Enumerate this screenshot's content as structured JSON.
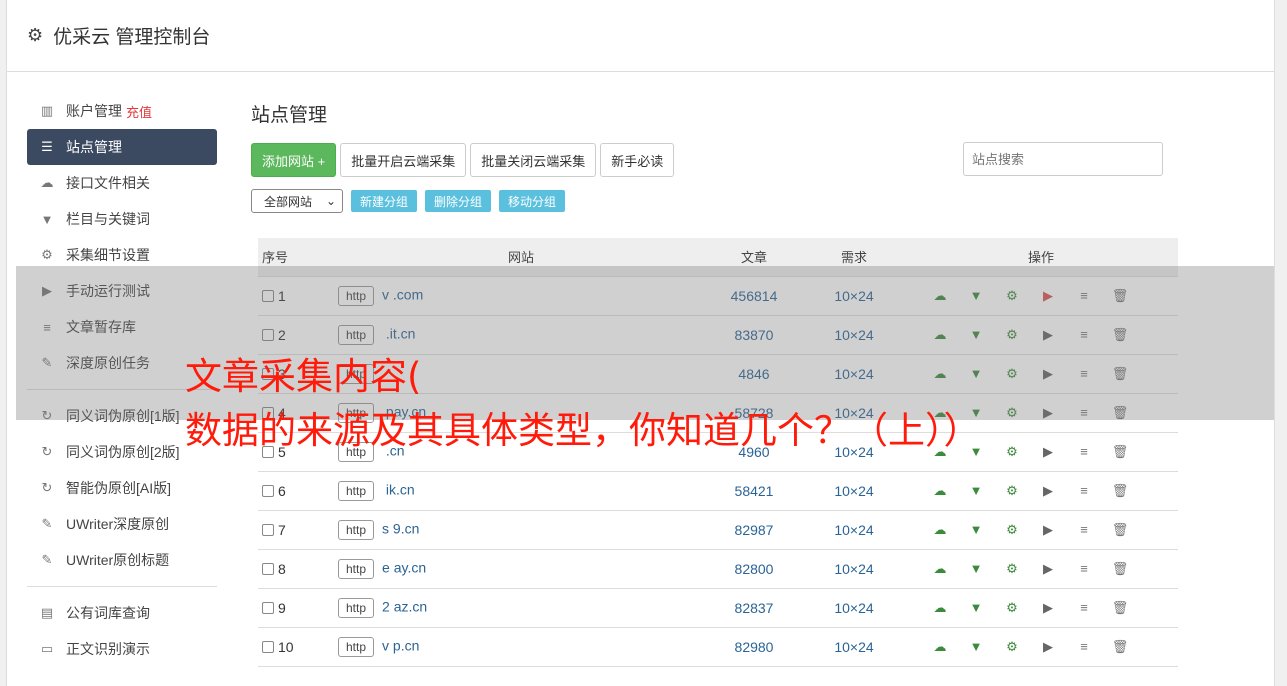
{
  "header": {
    "title": "优采云 管理控制台"
  },
  "sidebar": {
    "items": [
      {
        "label": "账户管理",
        "extra": "充值",
        "icon": "bar-chart-icon",
        "glyph": "▥",
        "active": false
      },
      {
        "label": "站点管理",
        "icon": "server-icon",
        "glyph": "☰",
        "active": true
      },
      {
        "label": "接口文件相关",
        "icon": "cloud-upload-icon",
        "glyph": "☁",
        "active": false
      },
      {
        "label": "栏目与关键词",
        "icon": "filter-icon",
        "glyph": "▼",
        "active": false
      },
      {
        "label": "采集细节设置",
        "icon": "cogs-icon",
        "glyph": "⚙",
        "active": false
      },
      {
        "label": "手动运行测试",
        "icon": "play-circle-icon",
        "glyph": "▶",
        "active": false
      },
      {
        "label": "文章暂存库",
        "icon": "database-icon",
        "glyph": "≡",
        "active": false
      },
      {
        "label": "深度原创任务",
        "icon": "edit-icon",
        "glyph": "✎",
        "active": false
      }
    ],
    "items2": [
      {
        "label": "同义词伪原创[1版]",
        "icon": "refresh-icon",
        "glyph": "↻"
      },
      {
        "label": "同义词伪原创[2版]",
        "icon": "refresh-icon",
        "glyph": "↻"
      },
      {
        "label": "智能伪原创[AI版]",
        "icon": "refresh-icon",
        "glyph": "↻"
      },
      {
        "label": "UWriter深度原创",
        "icon": "edit-icon",
        "glyph": "✎"
      },
      {
        "label": "UWriter原创标题",
        "icon": "edit-icon",
        "glyph": "✎"
      }
    ],
    "items3": [
      {
        "label": "公有词库查询",
        "icon": "book-icon",
        "glyph": "▤"
      },
      {
        "label": "正文识别演示",
        "icon": "monitor-icon",
        "glyph": "▭"
      }
    ]
  },
  "main": {
    "title": "站点管理",
    "add_site": "添加网站 +",
    "batch_open": "批量开启云端采集",
    "batch_close": "批量关闭云端采集",
    "newbie": "新手必读",
    "search_placeholder": "站点搜索",
    "group_select": "全部网站",
    "new_group": "新建分组",
    "delete_group": "删除分组",
    "move_group": "移动分组"
  },
  "table": {
    "headers": [
      "序号",
      "网站",
      "文章",
      "需求",
      "操作"
    ],
    "rows": [
      {
        "no": "1",
        "proto": "http",
        "site": "v          .com",
        "articles": "456814",
        "req": "10×24",
        "red": true
      },
      {
        "no": "2",
        "proto": "http",
        "site": "       .it.cn",
        "articles": "83870",
        "req": "10×24",
        "red": false
      },
      {
        "no": "3",
        "proto": "http",
        "site": "",
        "articles": "4846",
        "req": "10×24",
        "red": false
      },
      {
        "no": "4",
        "proto": "http",
        "site": "      pay.cn",
        "articles": "58728",
        "req": "10×24",
        "red": false
      },
      {
        "no": "5",
        "proto": "http",
        "site": "       .cn",
        "articles": "4960",
        "req": "10×24",
        "red": false
      },
      {
        "no": "6",
        "proto": "http",
        "site": "     ik.cn",
        "articles": "58421",
        "req": "10×24",
        "red": false
      },
      {
        "no": "7",
        "proto": "http",
        "site": "s    9.cn",
        "articles": "82987",
        "req": "10×24",
        "red": false
      },
      {
        "no": "8",
        "proto": "http",
        "site": "e     ay.cn",
        "articles": "82800",
        "req": "10×24",
        "red": false
      },
      {
        "no": "9",
        "proto": "http",
        "site": "2     az.cn",
        "articles": "82837",
        "req": "10×24",
        "red": false
      },
      {
        "no": "10",
        "proto": "http",
        "site": "v     p.cn",
        "articles": "82980",
        "req": "10×24",
        "red": false
      }
    ]
  },
  "overlay": {
    "line1": "文章采集内容(",
    "line2": "数据的来源及其具体类型，你知道几个？（上））",
    "color": "#ff1a0a"
  }
}
